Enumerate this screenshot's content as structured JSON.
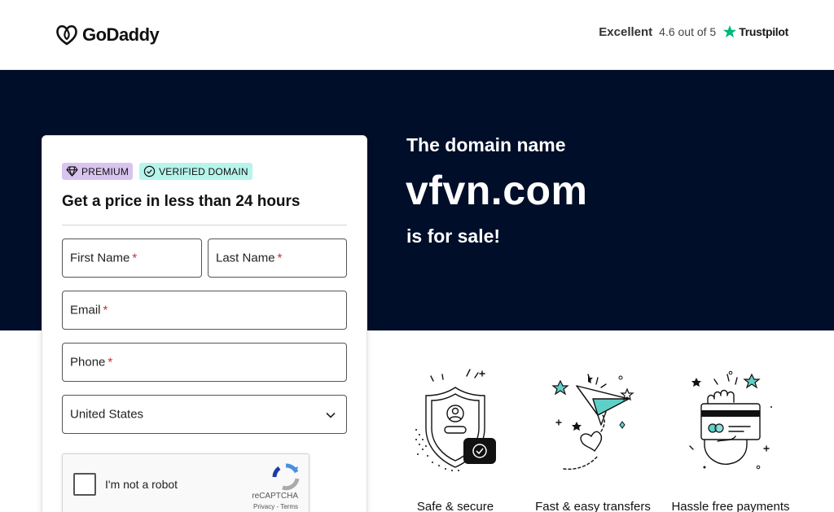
{
  "header": {
    "logo_text": "GoDaddy",
    "trustpilot": {
      "rating_word": "Excellent",
      "score_text": "4.6 out of 5",
      "brand": "Trustpilot",
      "star_color": "#00b67a"
    }
  },
  "hero": {
    "pre_text": "The domain name",
    "domain": "vfvn.com",
    "post_text": "is for sale!",
    "background": "#000e29"
  },
  "form": {
    "badges": [
      {
        "label": "PREMIUM",
        "icon": "diamond-icon",
        "color": "#d8c4ef"
      },
      {
        "label": "VERIFIED DOMAIN",
        "icon": "check-circle-icon",
        "color": "#b7f4ec"
      }
    ],
    "title": "Get a price in less than 24 hours",
    "fields": {
      "first_name": "First Name",
      "last_name": "Last Name",
      "email": "Email",
      "phone": "Phone",
      "required_mark": "*"
    },
    "country": {
      "selected": "United States"
    },
    "recaptcha": {
      "label": "I'm not a robot",
      "brand": "reCAPTCHA",
      "links": "Privacy - Terms"
    }
  },
  "features": [
    {
      "label": "Safe & secure",
      "icon": "shield-user-icon"
    },
    {
      "label": "Fast & easy transfers",
      "icon": "paper-plane-icon"
    },
    {
      "label": "Hassle free payments",
      "icon": "hand-card-icon"
    }
  ]
}
